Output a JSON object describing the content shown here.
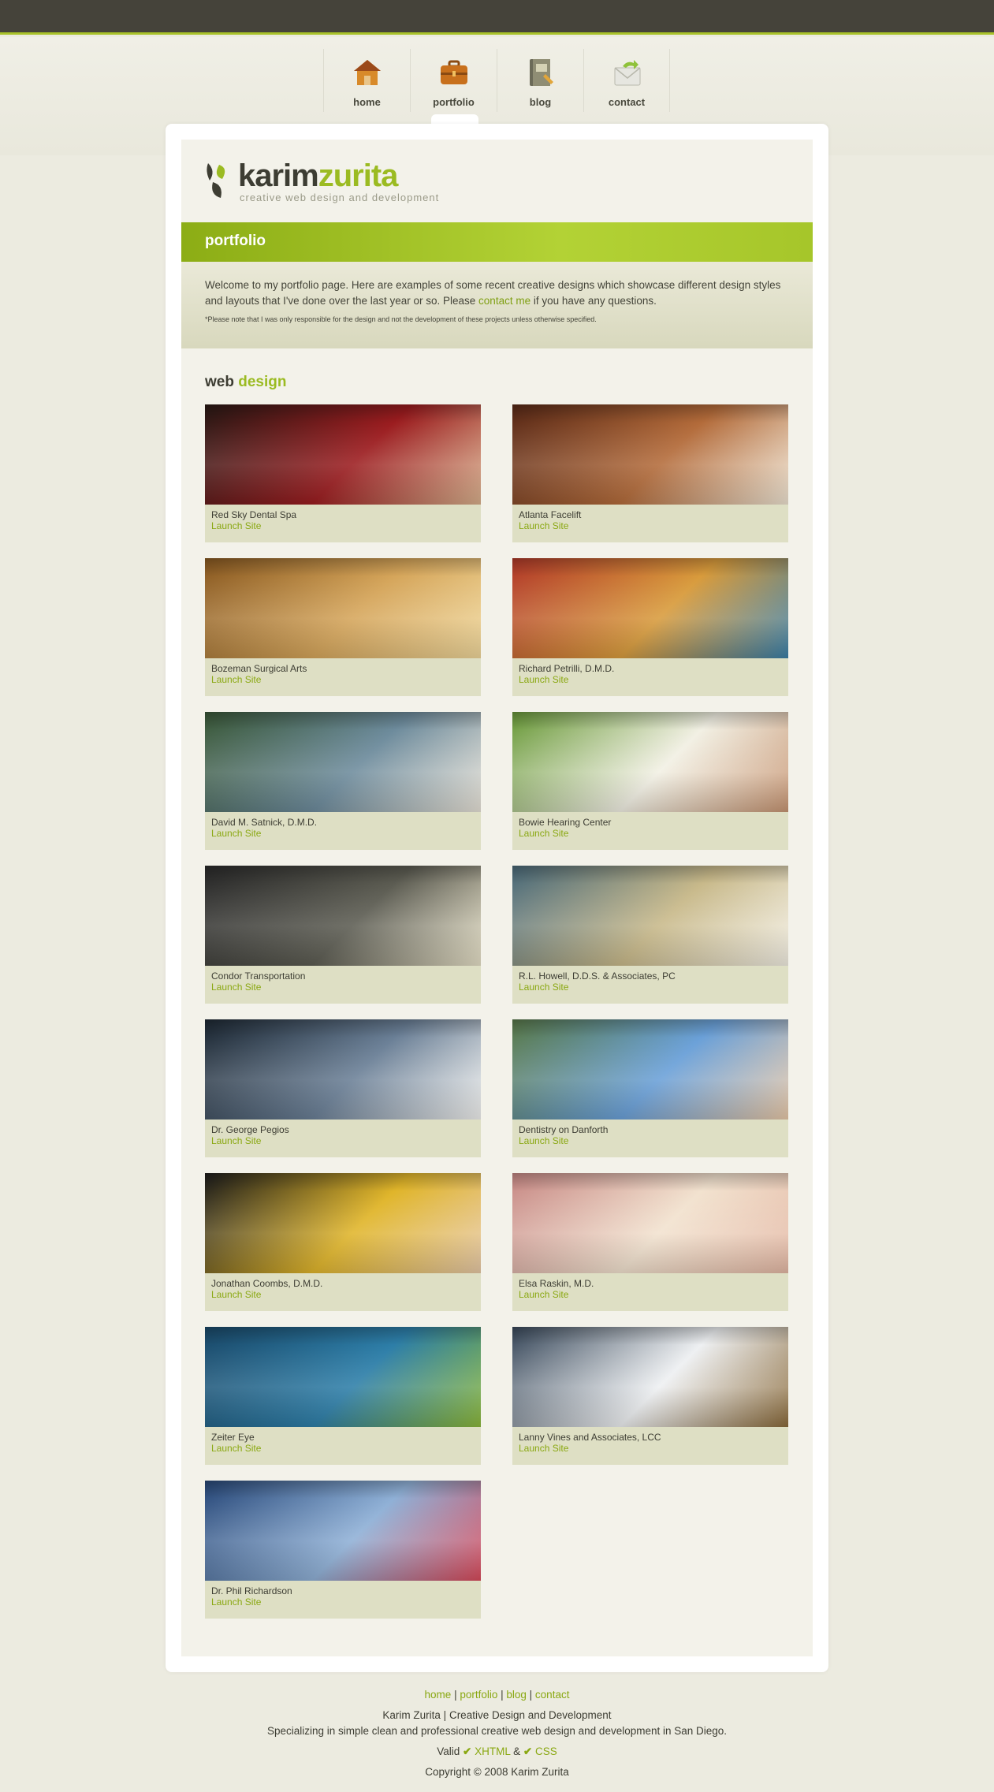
{
  "nav": {
    "items": [
      {
        "label": "home",
        "icon": "house-icon"
      },
      {
        "label": "portfolio",
        "icon": "briefcase-icon"
      },
      {
        "label": "blog",
        "icon": "notebook-icon"
      },
      {
        "label": "contact",
        "icon": "envelope-icon"
      }
    ],
    "active": "portfolio"
  },
  "logo": {
    "brand_a": "karim",
    "brand_b": "zurita",
    "tagline": "creative web design and development"
  },
  "banner": {
    "title": "portfolio"
  },
  "intro": {
    "text_before": "Welcome to my portfolio page. Here are examples of some recent creative designs which showcase different design styles and layouts that I've done over the last year or so. Please ",
    "link": "contact me",
    "text_after": " if you have any questions.",
    "note": "*Please note that I was only responsible for the design and not the development of these projects unless otherwise specified."
  },
  "section": {
    "title_a": "web",
    "title_b": " design"
  },
  "launch_label": "Launch Site",
  "projects": [
    {
      "name": "Red Sky Dental Spa",
      "colors": [
        "#2a1a16",
        "#9b1c1f",
        "#d9b08c"
      ]
    },
    {
      "name": "Atlanta Facelift",
      "colors": [
        "#5a2a18",
        "#b36b3a",
        "#efe4d2"
      ]
    },
    {
      "name": "Bozeman Surgical Arts",
      "colors": [
        "#8a5a22",
        "#d5a55a",
        "#f0d79a"
      ]
    },
    {
      "name": "Richard Petrilli, D.M.D.",
      "colors": [
        "#b23a2a",
        "#d89b3c",
        "#3a7fa8"
      ]
    },
    {
      "name": "David M. Satnick, D.M.D.",
      "colors": [
        "#3c5a3a",
        "#6d8b9c",
        "#e8e3d8"
      ]
    },
    {
      "name": "Bowie Hearing Center",
      "colors": [
        "#6a9a3a",
        "#f2f0e4",
        "#c79572"
      ]
    },
    {
      "name": "Condor Transportation",
      "colors": [
        "#2b2b2b",
        "#5c5c52",
        "#e7e1c8"
      ]
    },
    {
      "name": "R.L. Howell, D.D.S. & Associates, PC",
      "colors": [
        "#4a6a7a",
        "#c8b98a",
        "#f3efe3"
      ]
    },
    {
      "name": "Dr. George Pegios",
      "colors": [
        "#1f2a35",
        "#6a7f96",
        "#f2f2f0"
      ]
    },
    {
      "name": "Dentistry on Danforth",
      "colors": [
        "#5a7a4a",
        "#6aa0d8",
        "#e9c9a8"
      ]
    },
    {
      "name": "Jonathan Coombs, D.M.D.",
      "colors": [
        "#1e1e1e",
        "#e0b52a",
        "#e7c9a6"
      ]
    },
    {
      "name": "Elsa Raskin, M.D.",
      "colors": [
        "#c88a86",
        "#f2e2cf",
        "#e4b8a4"
      ]
    },
    {
      "name": "Zeiter Eye",
      "colors": [
        "#1b4a6a",
        "#2d7ea8",
        "#8bb83a"
      ]
    },
    {
      "name": "Lanny Vines and Associates, LCC",
      "colors": [
        "#3a4a5c",
        "#eef0f2",
        "#8a6a3a"
      ]
    },
    {
      "name": "Dr. Phil Richardson",
      "colors": [
        "#2a4a7a",
        "#8fb0d6",
        "#d84a5a"
      ]
    }
  ],
  "footer": {
    "links": [
      "home",
      "portfolio",
      "blog",
      "contact"
    ],
    "line1": "Karim Zurita | Creative Design and Development",
    "line2": "Specializing in simple clean and professional creative web design and development in San Diego.",
    "valid_label": "Valid",
    "xhtml": "XHTML",
    "amp": "&",
    "css": "CSS",
    "copyright": "Copyright © 2008 Karim Zurita"
  }
}
